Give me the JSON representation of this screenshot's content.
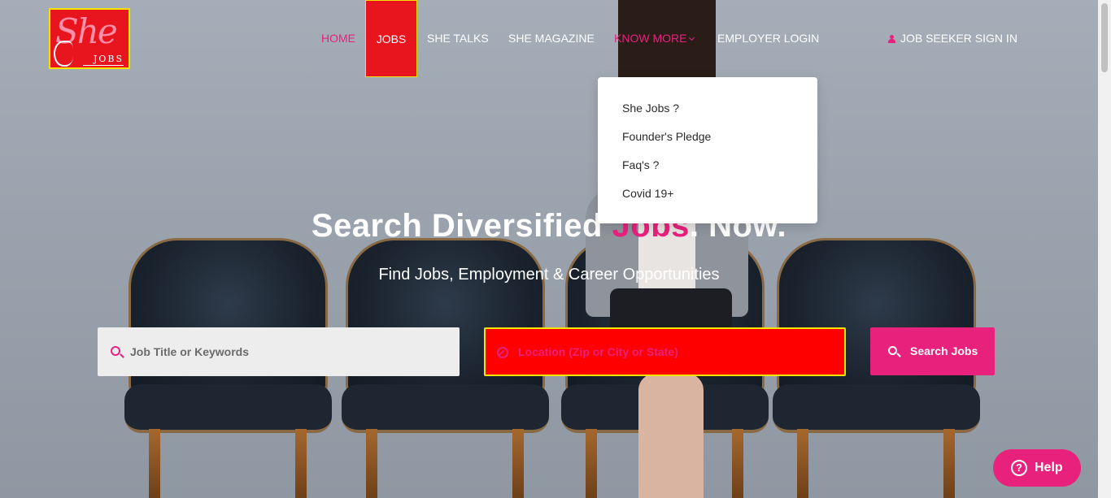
{
  "logo": {
    "main": "She",
    "sub": "JOBS"
  },
  "nav": {
    "home": "HOME",
    "jobs": "JOBS",
    "she_talks": "SHE TALKS",
    "she_magazine": "SHE MAGAZINE",
    "know_more": "KNOW MORE",
    "employer_login": "EMPLOYER LOGIN",
    "job_seeker_sign_in": "JOB SEEKER SIGN IN"
  },
  "dropdown": {
    "items": [
      "She Jobs ?",
      "Founder's Pledge",
      "Faq's ?",
      "Covid 19+"
    ]
  },
  "hero": {
    "headline_part1": "Search Diversified ",
    "headline_highlight": "Jobs",
    "headline_part2": ". Now.",
    "subline": "Find Jobs, Employment & Career Opportunities"
  },
  "search": {
    "keywords_placeholder": "Job Title or Keywords",
    "location_placeholder": "Location (Zip or City or State)",
    "button_label": "Search Jobs"
  },
  "help": {
    "label": "Help"
  },
  "colors": {
    "accent_pink": "#e8217d",
    "brand_red": "#e8151f",
    "location_bg": "#ff0000",
    "highlight_yellow": "#f5e400"
  }
}
